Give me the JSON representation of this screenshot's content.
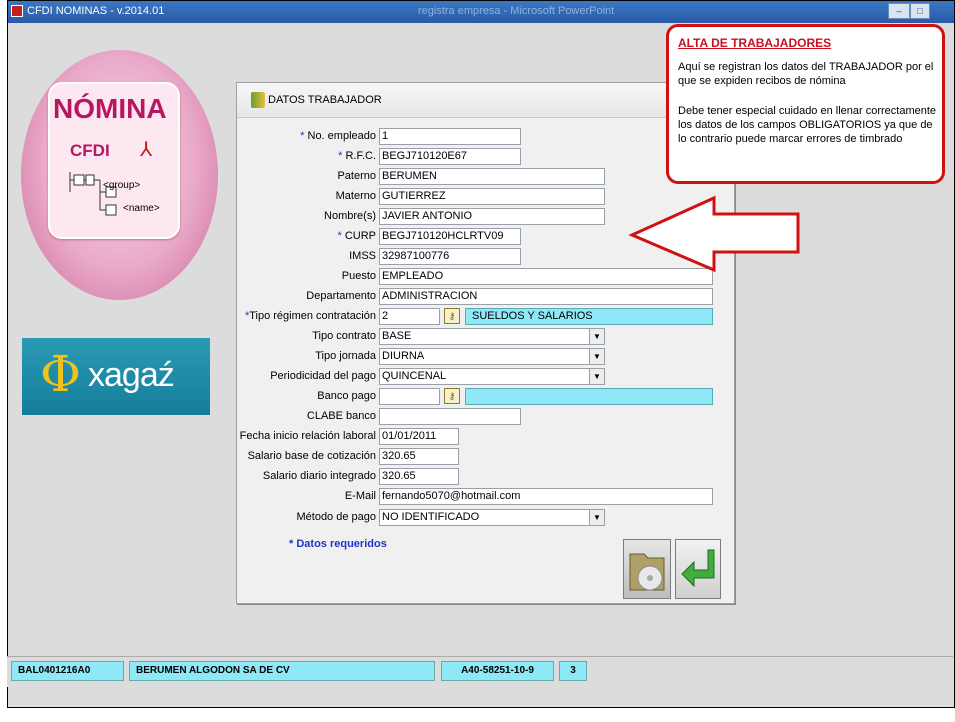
{
  "window": {
    "title": "CFDI NOMINAS - v.2014.01",
    "background_title": "registra empresa - Microsoft PowerPoint"
  },
  "logo": {
    "title": "NÓMINA",
    "subtitle": "CFDI",
    "tree_group": "<group>",
    "tree_name": "<name>"
  },
  "brand": {
    "text": "xagaź",
    "symbol": "Φ"
  },
  "dialog": {
    "title": "DATOS TRABAJADOR",
    "fields": {
      "no_empleado": {
        "label": "No. empleado",
        "value": "1"
      },
      "rfc": {
        "label": "R.F.C.",
        "value": "BEGJ710120E67"
      },
      "paterno": {
        "label": "Paterno",
        "value": "BERUMEN"
      },
      "materno": {
        "label": "Materno",
        "value": "GUTIERREZ"
      },
      "nombres": {
        "label": "Nombre(s)",
        "value": "JAVIER ANTONIO"
      },
      "curp": {
        "label": "CURP",
        "value": "BEGJ710120HCLRTV09"
      },
      "imss": {
        "label": "IMSS",
        "value": "32987100776"
      },
      "puesto": {
        "label": "Puesto",
        "value": "EMPLEADO"
      },
      "departamento": {
        "label": "Departamento",
        "value": "ADMINISTRACION"
      },
      "tipo_regimen": {
        "label": "Tipo régimen contratación",
        "value": "2",
        "description": "SUELDOS Y SALARIOS"
      },
      "tipo_contrato": {
        "label": "Tipo contrato",
        "value": "BASE"
      },
      "tipo_jornada": {
        "label": "Tipo jornada",
        "value": "DIURNA"
      },
      "periodicidad": {
        "label": "Periodicidad del pago",
        "value": "QUINCENAL"
      },
      "banco_pago": {
        "label": "Banco pago",
        "value": "",
        "description": ""
      },
      "clabe": {
        "label": "CLABE banco",
        "value": ""
      },
      "fecha_inicio": {
        "label": "Fecha inicio relación laboral",
        "value": "01/01/2011"
      },
      "salario_base": {
        "label": "Salario base de cotización",
        "value": "320.65"
      },
      "salario_diario": {
        "label": "Salario diario integrado",
        "value": "320.65"
      },
      "email": {
        "label": "E-Mail",
        "value": "fernando5070@hotmail.com"
      },
      "metodo_pago": {
        "label": "Método de pago",
        "value": "NO IDENTIFICADO"
      }
    },
    "required_note": "Datos requeridos",
    "required_mark": "*"
  },
  "statusbar": {
    "rfc": "BAL0401216A0",
    "company": "BERUMEN ALGODON SA DE CV",
    "registro": "A40-58251-10-9",
    "number": "3"
  },
  "callout": {
    "title": "ALTA DE TRABAJADORES",
    "paragraph1": "Aquí se registran los datos del TRABAJADOR por el que se expiden recibos de nómina",
    "paragraph2": "Debe tener especial cuidado en llenar correctamente los datos de los campos OBLIGATORIOS ya que de lo contrario puede marcar errores de timbrado"
  },
  "colors": {
    "accent_cyan": "#8ee8f5",
    "callout_red": "#d01111",
    "required_blue": "#2233cc",
    "brand_magenta": "#b6185f"
  },
  "icons": [
    "app-icon",
    "pdf-icon",
    "key-icon",
    "chevron-down-icon",
    "disk-icon",
    "enter-arrow-icon",
    "arrow-pointer-icon"
  ]
}
